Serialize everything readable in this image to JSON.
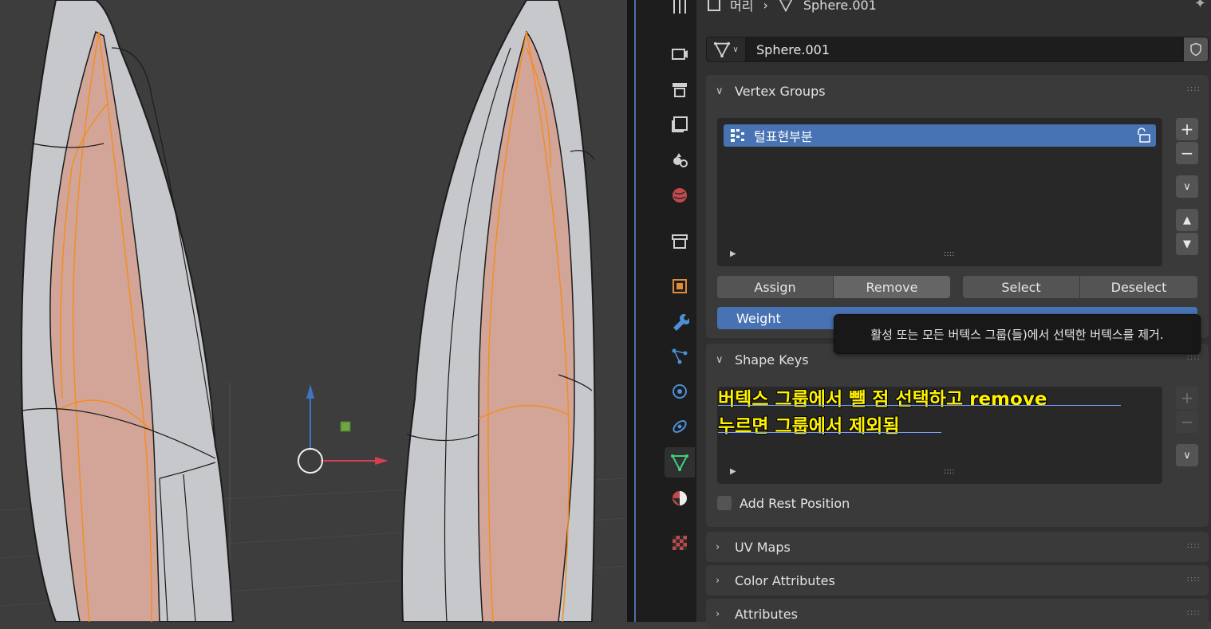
{
  "viewport": {
    "colors": {
      "background": "#3d3d3d",
      "mesh": "#c9cbce",
      "selected_edge": "#f59a2a",
      "face_tint": "#d9a79a"
    }
  },
  "properties": {
    "breadcrumb": {
      "object": "머리",
      "mesh": "Sphere.001"
    },
    "datablock": {
      "name": "Sphere.001"
    },
    "vertex_groups": {
      "header": "Vertex Groups",
      "items": [
        {
          "name": "털표현부분",
          "active": true
        }
      ],
      "buttons": {
        "assign": "Assign",
        "remove": "Remove",
        "select": "Select",
        "deselect": "Deselect"
      },
      "weight_label": "Weight"
    },
    "tooltip": "활성 또는 모든 버텍스 그룹(들)에서 선택한 버텍스를 제거.",
    "shape_keys": {
      "header": "Shape Keys",
      "add_rest_position": "Add Rest Position"
    },
    "collapsed_panels": [
      "UV Maps",
      "Color Attributes",
      "Attributes"
    ]
  },
  "annotation": {
    "line1": "버텍스 그룹에서 뺄 점 선택하고 remove",
    "line2": "누르면 그룹에서 제외됨"
  },
  "colors": {
    "accent": "#4772b3",
    "annotation": "#fff200",
    "panel": "#3a3a3a"
  }
}
